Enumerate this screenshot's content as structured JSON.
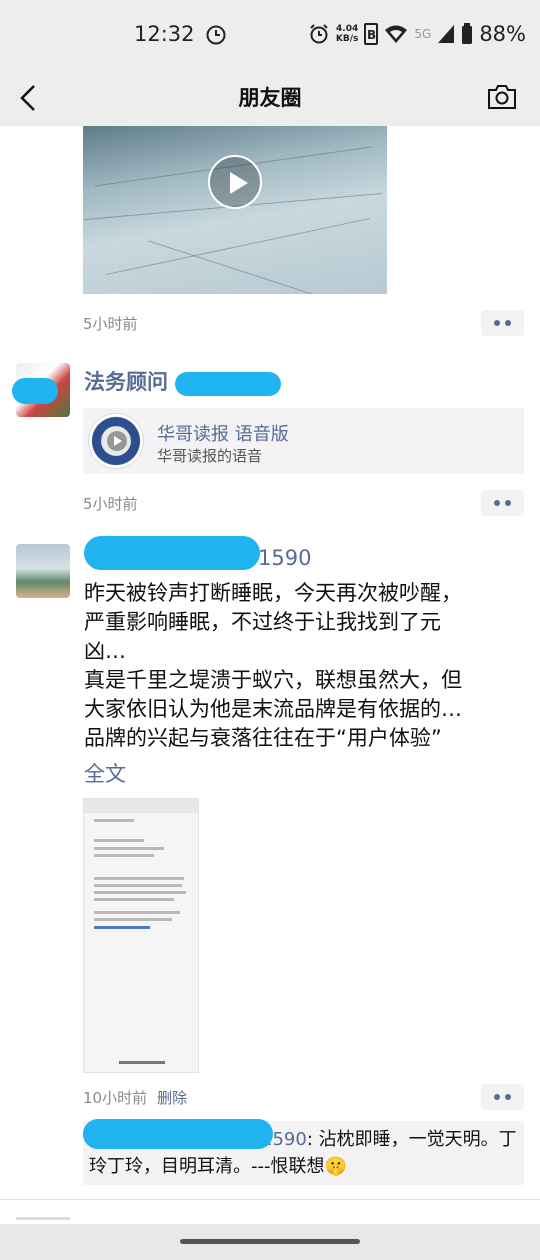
{
  "status_bar": {
    "time": "12:32",
    "net_speed_value": "4.04",
    "net_speed_unit": "KB/s",
    "signal_label": "5G",
    "battery": "88%"
  },
  "nav": {
    "title": "朋友圈"
  },
  "posts": [
    {
      "time": "5小时前"
    },
    {
      "author": "法务顾问",
      "share": {
        "title": "华哥读报 语音版",
        "subtitle": "华哥读报的语音"
      },
      "time": "5小时前"
    },
    {
      "author_tail": "1590",
      "text_lines": [
        "昨天被铃声打断睡眠，今天再次被吵醒，",
        "严重影响睡眠，不过终于让我找到了元",
        "凶…",
        "真是千里之堤溃于蚁穴，联想虽然大，但",
        "大家依旧认为他是末流品牌是有依据的…",
        "品牌的兴起与衰落往往在于“用户体验”"
      ],
      "full_text_label": "全文",
      "time": "10小时前",
      "delete_label": "删除",
      "comment": {
        "name_tail": "1590",
        "text": ": 沾枕即睡，一觉天明。丁玲丁玲，目明耳清。---恨联想",
        "emoji": "🤫"
      }
    }
  ]
}
